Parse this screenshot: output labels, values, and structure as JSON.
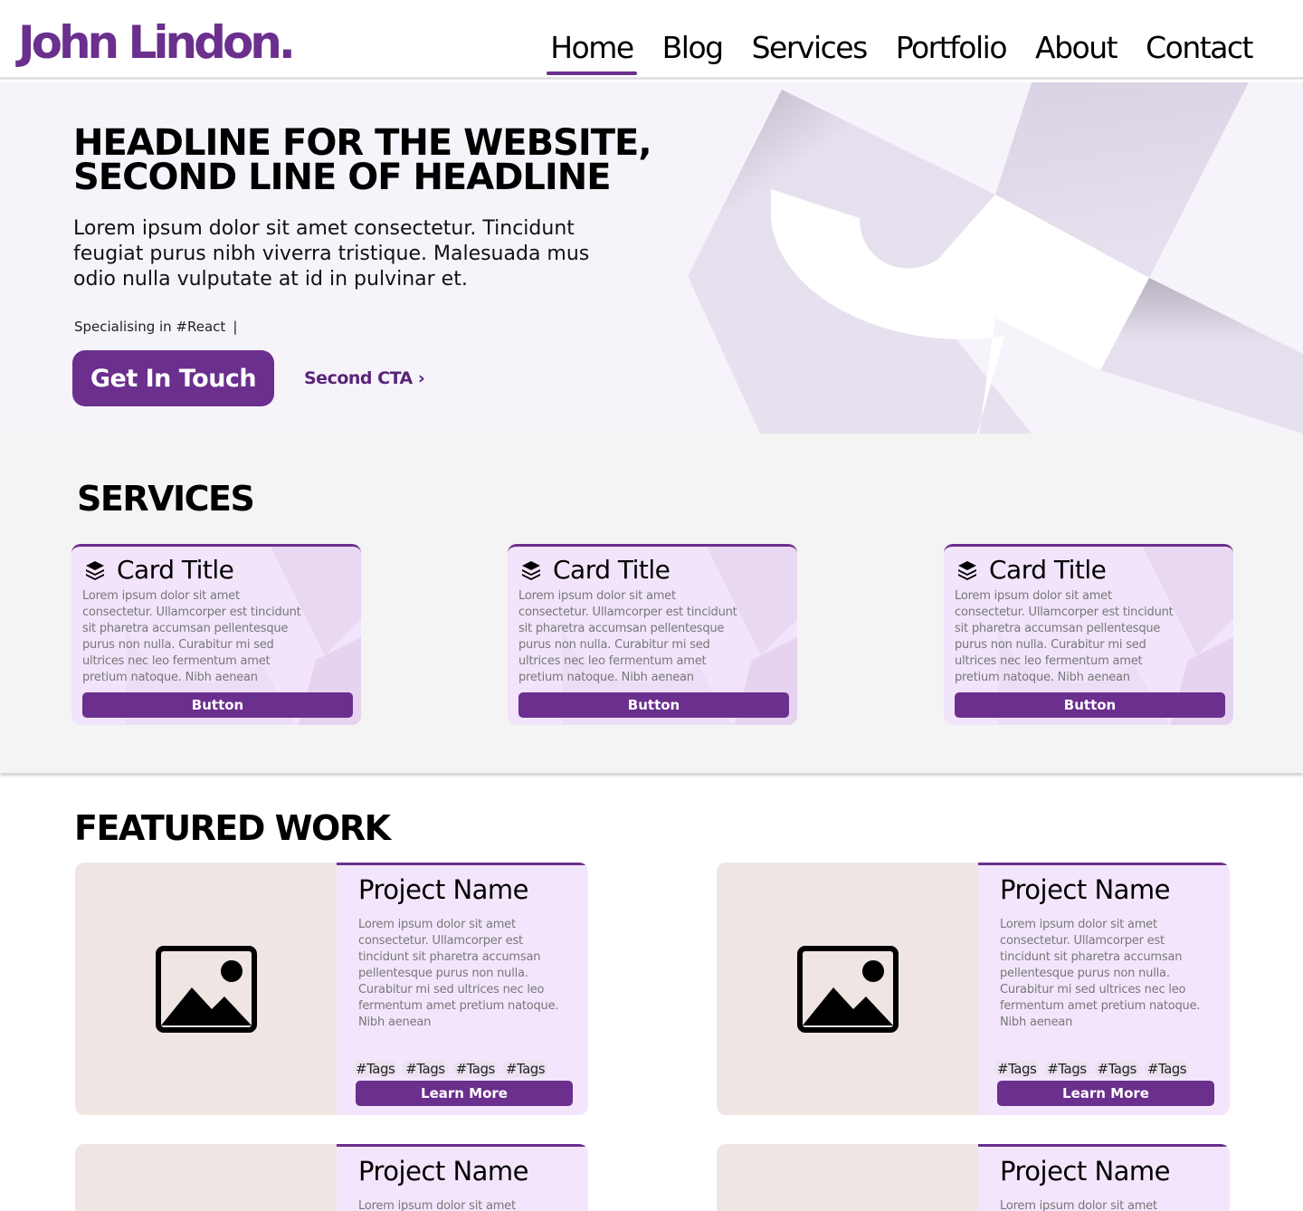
{
  "header": {
    "logo": "John Lindon.",
    "nav": [
      {
        "label": "Home",
        "active": true
      },
      {
        "label": "Blog"
      },
      {
        "label": "Services"
      },
      {
        "label": "Portfolio"
      },
      {
        "label": "About"
      },
      {
        "label": "Contact"
      }
    ]
  },
  "hero": {
    "headline_line1": "HEADLINE FOR THE WEBSITE,",
    "headline_line2": "SECOND LINE OF HEADLINE",
    "lead": "Lorem ipsum dolor sit amet consectetur. Tincidunt feugiat purus nibh viverra tristique. Malesuada mus odio nulla vulputate at id in pulvinar et.",
    "specialising": "Specialising in #React",
    "caret": "|",
    "primary_cta": "Get In Touch",
    "secondary_cta": "Second CTA",
    "secondary_cta_arrow": "›"
  },
  "services": {
    "title": "SERVICES",
    "cards": [
      {
        "title": "Card Title",
        "body": "Lorem ipsum dolor sit amet consectetur. Ullamcorper est tincidunt sit pharetra accumsan pellentesque purus non nulla. Curabitur mi sed ultrices nec leo fermentum amet pretium natoque. Nibh aenean",
        "button": "Button",
        "icon": "layers-icon"
      },
      {
        "title": "Card Title",
        "body": "Lorem ipsum dolor sit amet consectetur. Ullamcorper est tincidunt sit pharetra accumsan pellentesque purus non nulla. Curabitur mi sed ultrices nec leo fermentum amet pretium natoque. Nibh aenean",
        "button": "Button",
        "icon": "layers-icon"
      },
      {
        "title": "Card Title",
        "body": "Lorem ipsum dolor sit amet consectetur. Ullamcorper est tincidunt sit pharetra accumsan pellentesque purus non nulla. Curabitur mi sed ultrices nec leo fermentum amet pretium natoque. Nibh aenean",
        "button": "Button",
        "icon": "layers-icon"
      }
    ]
  },
  "featured": {
    "title": "FEATURED WORK",
    "projects": [
      {
        "name": "Project Name",
        "body": "Lorem ipsum dolor sit amet consectetur. Ullamcorper est tincidunt sit pharetra accumsan pellentesque purus non nulla. Curabitur mi sed ultrices nec leo fermentum amet pretium natoque. Nibh aenean",
        "tags": [
          "#Tags",
          "#Tags",
          "#Tags",
          "#Tags"
        ],
        "button": "Learn More",
        "icon": "image-placeholder-icon"
      },
      {
        "name": "Project Name",
        "body": "Lorem ipsum dolor sit amet consectetur. Ullamcorper est tincidunt sit pharetra accumsan pellentesque purus non nulla. Curabitur mi sed ultrices nec leo fermentum amet pretium natoque. Nibh aenean",
        "tags": [
          "#Tags",
          "#Tags",
          "#Tags",
          "#Tags"
        ],
        "button": "Learn More",
        "icon": "image-placeholder-icon"
      },
      {
        "name": "Project Name",
        "body": "Lorem ipsum dolor sit amet",
        "icon": "image-placeholder-icon"
      },
      {
        "name": "Project Name",
        "body": "Lorem ipsum dolor sit amet",
        "icon": "image-placeholder-icon"
      }
    ]
  },
  "colors": {
    "brand": "#6b2f8d",
    "hero_bg": "#f6f4fa",
    "card_bg": "#f1e4fb",
    "thumb_bg": "#efe6e3"
  }
}
